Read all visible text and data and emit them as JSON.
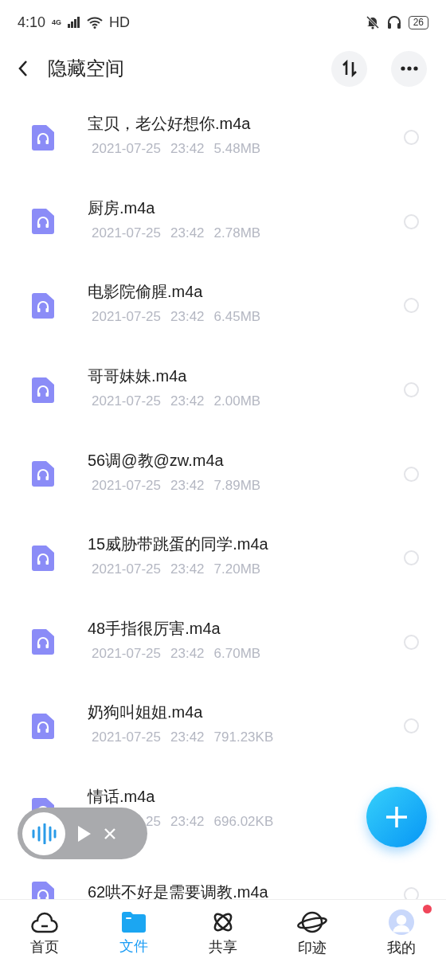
{
  "status_bar": {
    "time": "4:10",
    "network": "4G",
    "hd": "HD",
    "battery": "26",
    "muted": true,
    "headset": true
  },
  "header": {
    "title": "隐藏空间"
  },
  "files": [
    {
      "name": "宝贝，老公好想你.m4a",
      "date": "2021-07-25",
      "time": "23:42",
      "size": "5.48MB",
      "selected": false
    },
    {
      "name": "厨房.m4a",
      "date": "2021-07-25",
      "time": "23:42",
      "size": "2.78MB",
      "selected": false
    },
    {
      "name": "电影院偷腥.m4a",
      "date": "2021-07-25",
      "time": "23:42",
      "size": "6.45MB",
      "selected": false
    },
    {
      "name": "哥哥妹妹.m4a",
      "date": "2021-07-25",
      "time": "23:42",
      "size": "2.00MB",
      "selected": false
    },
    {
      "name": "56调@教@zw.m4a",
      "date": "2021-07-25",
      "time": "23:42",
      "size": "7.89MB",
      "selected": false
    },
    {
      "name": "15威胁带跳蛋的同学.m4a",
      "date": "2021-07-25",
      "time": "23:42",
      "size": "7.20MB",
      "selected": false
    },
    {
      "name": "48手指很厉害.m4a",
      "date": "2021-07-25",
      "time": "23:42",
      "size": "6.70MB",
      "selected": false
    },
    {
      "name": "奶狗叫姐姐.m4a",
      "date": "2021-07-25",
      "time": "23:42",
      "size": "791.23KB",
      "selected": false
    },
    {
      "name": "情话.m4a",
      "date": "25",
      "time": "23:42",
      "size": "696.02KB"
    },
    {
      "name": "62哄不好是需要调教.m4a",
      "selected": false
    }
  ],
  "player": {
    "playing": false
  },
  "nav": [
    {
      "label": "首页",
      "kind": "cloud",
      "selected": false
    },
    {
      "label": "文件",
      "kind": "folder",
      "selected": true
    },
    {
      "label": "共享",
      "kind": "atom",
      "selected": false
    },
    {
      "label": "印迹",
      "kind": "planet",
      "selected": false
    },
    {
      "label": "我的",
      "kind": "avatar",
      "selected": false,
      "badge": true
    }
  ]
}
